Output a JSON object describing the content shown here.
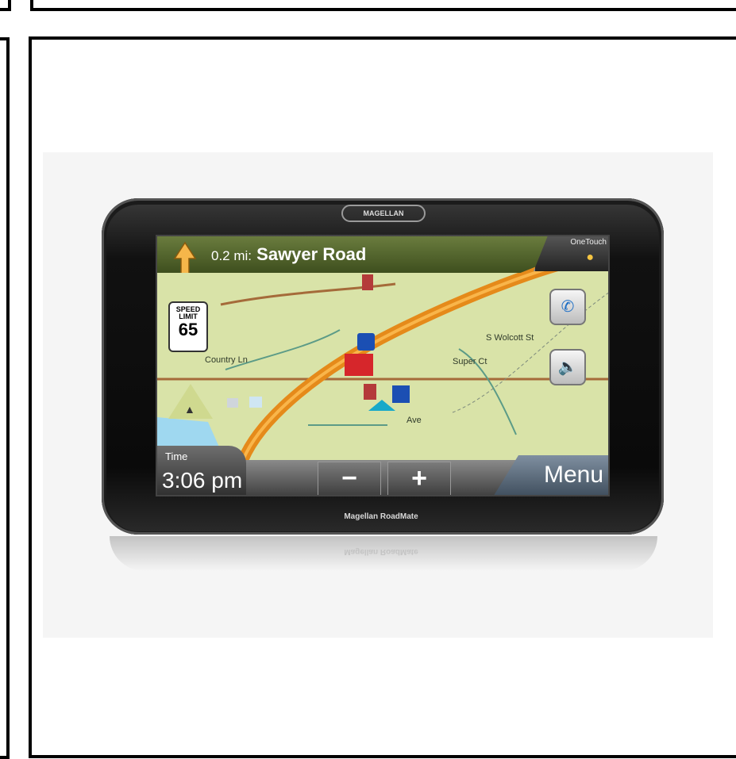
{
  "device": {
    "brand_top": "MAGELLAN",
    "brand_bottom": "Magellan RoadMate"
  },
  "navigation": {
    "distance": "0.2 mi:",
    "road": "Sawyer Road",
    "onetouch_label": "OneTouch"
  },
  "speed_limit": {
    "label_top": "SPEED",
    "label_bottom": "LIMIT",
    "value": "65"
  },
  "map": {
    "streets": [
      "Country Ln",
      "S Wolcott St",
      "Super Ct",
      "Ave"
    ],
    "route_color": "#e58a1a",
    "land_color": "#d9e3a8",
    "water_color": "#9fd8f0"
  },
  "status": {
    "time_label": "Time",
    "time_value": "3:06 pm"
  },
  "controls": {
    "zoom_out": "−",
    "zoom_in": "+",
    "menu": "Menu"
  }
}
